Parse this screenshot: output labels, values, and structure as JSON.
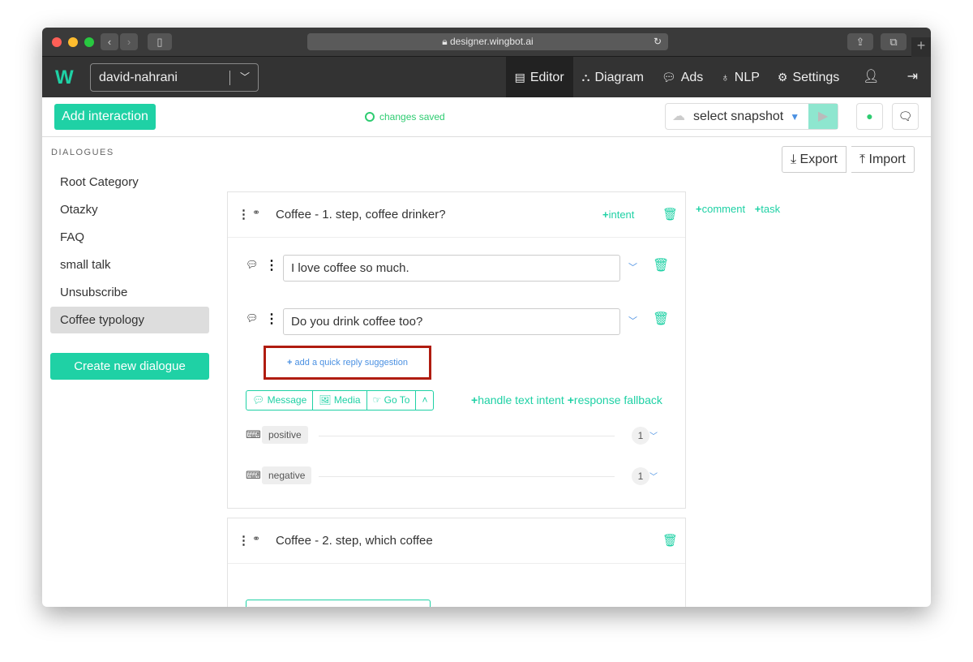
{
  "browser": {
    "url": "designer.wingbot.ai"
  },
  "nav": {
    "logo": "W",
    "project": "david-nahrani",
    "items": [
      {
        "icon": "editor-icon",
        "label": "Editor"
      },
      {
        "icon": "diagram-icon",
        "label": "Diagram"
      },
      {
        "icon": "chat-icon",
        "label": "Ads"
      },
      {
        "icon": "bulb-icon",
        "label": "NLP"
      },
      {
        "icon": "gears-icon",
        "label": "Settings"
      }
    ]
  },
  "toolbar": {
    "add_interaction": "Add interaction",
    "status": "changes saved",
    "snapshot": "select snapshot"
  },
  "sidebar": {
    "heading": "DIALOGUES",
    "items": [
      "Root Category",
      "Otazky",
      "FAQ",
      "small talk",
      "Unsubscribe",
      "Coffee typology"
    ],
    "active": "Coffee typology",
    "create": "Create new dialogue"
  },
  "actions": {
    "export": "Export",
    "import": "Import",
    "comment": "comment",
    "task": "task"
  },
  "interactions": [
    {
      "title": "Coffee - 1. step, coffee drinker?",
      "intent_link": "intent",
      "messages": [
        "I love coffee so much.",
        "Do you drink coffee too?"
      ],
      "quick_reply": "add a quick reply suggestion",
      "buttons": [
        "Message",
        "Media",
        "Go To"
      ],
      "handle_text_intent": "handle text intent",
      "response_fallback": "response fallback",
      "intents": [
        {
          "name": "positive",
          "count": "1"
        },
        {
          "name": "negative",
          "count": "1"
        }
      ]
    },
    {
      "title": "Coffee - 2. step, which coffee"
    }
  ],
  "colors": {
    "accent": "#1fd1a5",
    "link": "#4a90e2",
    "highlight": "#b01c10"
  }
}
